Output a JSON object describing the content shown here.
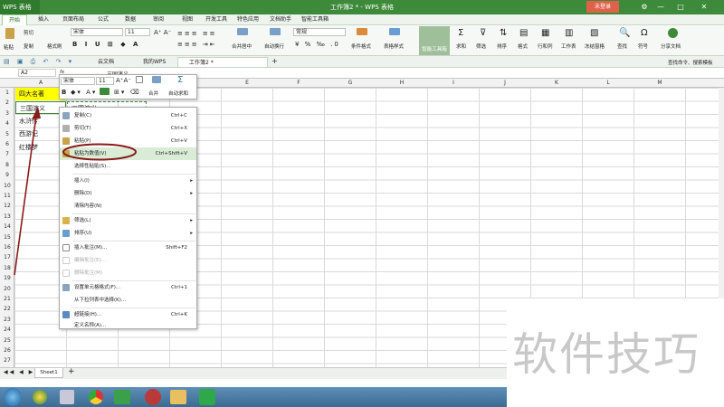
{
  "titlebar": {
    "app": "WPS 表格",
    "doc_title": "工作簿2 * - WPS 表格",
    "login": "未登录",
    "controls": [
      "⚙",
      "—",
      "□",
      "✕"
    ]
  },
  "menu_tabs": [
    "开始",
    "插入",
    "页面布局",
    "公式",
    "数据",
    "审阅",
    "视图",
    "开发工具",
    "特色应用",
    "文档助手",
    "智能工具箱"
  ],
  "ribbon": {
    "cut": "剪切",
    "paste": "粘贴",
    "copy": "复制",
    "format_painter": "格式刷",
    "font_name": "宋体",
    "font_size": "11",
    "merge": "合并居中",
    "wrap": "自动换行",
    "number_format": "常规",
    "cond_format": "条件格式",
    "table_style": "表格样式",
    "smart_toolbox": "智能工具箱",
    "sum": "求和",
    "filter": "筛选",
    "sort": "排序",
    "format": "格式",
    "row_col": "行和列",
    "worksheet": "工作表",
    "freeze": "冻结窗格",
    "find": "查找",
    "symbol": "符号",
    "share": "分享文档"
  },
  "doc_tabs": [
    "云文档",
    "我的WPS",
    "工作簿2 *"
  ],
  "search_cmd": "查找命令、搜索模板",
  "formula": {
    "cellref": "A2",
    "fx": "fx",
    "content": "三国演义"
  },
  "columns": [
    "A",
    "B",
    "C",
    "D",
    "E",
    "F",
    "G",
    "H",
    "I",
    "J",
    "K",
    "L",
    "M"
  ],
  "rows": [
    "1",
    "2",
    "3",
    "4",
    "5",
    "6",
    "7",
    "8",
    "9",
    "10",
    "11",
    "12",
    "13",
    "14",
    "15",
    "16",
    "17",
    "18",
    "19",
    "20",
    "21",
    "22",
    "23",
    "24",
    "25",
    "26",
    "27"
  ],
  "cells": {
    "a1": "四大名著",
    "a2": "三国演义",
    "a3": "水浒传",
    "a4": "西游记",
    "a5": "红楼梦",
    "b2": "三国演义"
  },
  "minibar": {
    "font": "宋体",
    "size": "11",
    "merge": "合并",
    "autosum": "自动求和",
    "bold": "B"
  },
  "context_menu": [
    {
      "label": "复制(C)",
      "shortcut": "Ctrl+C"
    },
    {
      "label": "剪切(T)",
      "shortcut": "Ctrl+X"
    },
    {
      "label": "粘贴(P)",
      "shortcut": "Ctrl+V"
    },
    {
      "label": "粘贴为数值(V)",
      "shortcut": "Ctrl+Shift+V"
    },
    {
      "label": "选择性粘贴(S)...",
      "shortcut": ""
    },
    {
      "label": "插入(I)",
      "shortcut": ""
    },
    {
      "label": "删除(D)",
      "shortcut": ""
    },
    {
      "label": "清除内容(N)",
      "shortcut": ""
    },
    {
      "label": "筛选(L)",
      "shortcut": ""
    },
    {
      "label": "排序(U)",
      "shortcut": ""
    },
    {
      "label": "插入批注(M)...",
      "shortcut": "Shift+F2"
    },
    {
      "label": "编辑批注(E)...",
      "shortcut": ""
    },
    {
      "label": "删除批注(M)",
      "shortcut": ""
    },
    {
      "label": "设置单元格格式(F)...",
      "shortcut": "Ctrl+1"
    },
    {
      "label": "从下拉列表中选择(K)...",
      "shortcut": ""
    },
    {
      "label": "超链接(H)...",
      "shortcut": "Ctrl+K"
    },
    {
      "label": "定义名称(A)...",
      "shortcut": ""
    }
  ],
  "sheet_tab": "Sheet1",
  "watermark": "软件技巧",
  "colors": {
    "title_green": "#3d8a3a",
    "highlight_yellow": "#ffff00",
    "arrow_red": "#8b1a1a",
    "menu_highlight": "#d8ecd6"
  }
}
